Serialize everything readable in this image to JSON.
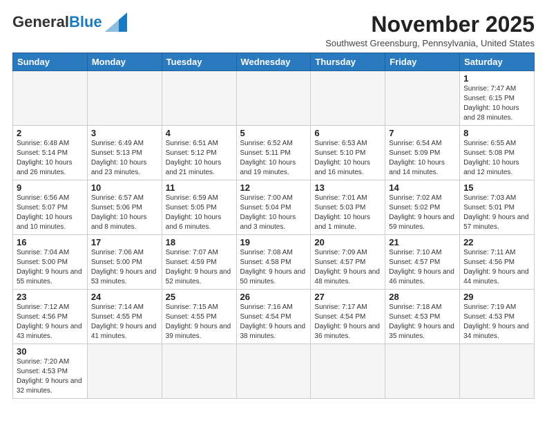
{
  "header": {
    "logo_general": "General",
    "logo_blue": "Blue",
    "month_title": "November 2025",
    "subtitle": "Southwest Greensburg, Pennsylvania, United States"
  },
  "days_of_week": [
    "Sunday",
    "Monday",
    "Tuesday",
    "Wednesday",
    "Thursday",
    "Friday",
    "Saturday"
  ],
  "weeks": [
    [
      {
        "day": "",
        "info": ""
      },
      {
        "day": "",
        "info": ""
      },
      {
        "day": "",
        "info": ""
      },
      {
        "day": "",
        "info": ""
      },
      {
        "day": "",
        "info": ""
      },
      {
        "day": "",
        "info": ""
      },
      {
        "day": "1",
        "info": "Sunrise: 7:47 AM\nSunset: 6:15 PM\nDaylight: 10 hours and 28 minutes."
      }
    ],
    [
      {
        "day": "2",
        "info": "Sunrise: 6:48 AM\nSunset: 5:14 PM\nDaylight: 10 hours and 26 minutes."
      },
      {
        "day": "3",
        "info": "Sunrise: 6:49 AM\nSunset: 5:13 PM\nDaylight: 10 hours and 23 minutes."
      },
      {
        "day": "4",
        "info": "Sunrise: 6:51 AM\nSunset: 5:12 PM\nDaylight: 10 hours and 21 minutes."
      },
      {
        "day": "5",
        "info": "Sunrise: 6:52 AM\nSunset: 5:11 PM\nDaylight: 10 hours and 19 minutes."
      },
      {
        "day": "6",
        "info": "Sunrise: 6:53 AM\nSunset: 5:10 PM\nDaylight: 10 hours and 16 minutes."
      },
      {
        "day": "7",
        "info": "Sunrise: 6:54 AM\nSunset: 5:09 PM\nDaylight: 10 hours and 14 minutes."
      },
      {
        "day": "8",
        "info": "Sunrise: 6:55 AM\nSunset: 5:08 PM\nDaylight: 10 hours and 12 minutes."
      }
    ],
    [
      {
        "day": "9",
        "info": "Sunrise: 6:56 AM\nSunset: 5:07 PM\nDaylight: 10 hours and 10 minutes."
      },
      {
        "day": "10",
        "info": "Sunrise: 6:57 AM\nSunset: 5:06 PM\nDaylight: 10 hours and 8 minutes."
      },
      {
        "day": "11",
        "info": "Sunrise: 6:59 AM\nSunset: 5:05 PM\nDaylight: 10 hours and 6 minutes."
      },
      {
        "day": "12",
        "info": "Sunrise: 7:00 AM\nSunset: 5:04 PM\nDaylight: 10 hours and 3 minutes."
      },
      {
        "day": "13",
        "info": "Sunrise: 7:01 AM\nSunset: 5:03 PM\nDaylight: 10 hours and 1 minute."
      },
      {
        "day": "14",
        "info": "Sunrise: 7:02 AM\nSunset: 5:02 PM\nDaylight: 9 hours and 59 minutes."
      },
      {
        "day": "15",
        "info": "Sunrise: 7:03 AM\nSunset: 5:01 PM\nDaylight: 9 hours and 57 minutes."
      }
    ],
    [
      {
        "day": "16",
        "info": "Sunrise: 7:04 AM\nSunset: 5:00 PM\nDaylight: 9 hours and 55 minutes."
      },
      {
        "day": "17",
        "info": "Sunrise: 7:06 AM\nSunset: 5:00 PM\nDaylight: 9 hours and 53 minutes."
      },
      {
        "day": "18",
        "info": "Sunrise: 7:07 AM\nSunset: 4:59 PM\nDaylight: 9 hours and 52 minutes."
      },
      {
        "day": "19",
        "info": "Sunrise: 7:08 AM\nSunset: 4:58 PM\nDaylight: 9 hours and 50 minutes."
      },
      {
        "day": "20",
        "info": "Sunrise: 7:09 AM\nSunset: 4:57 PM\nDaylight: 9 hours and 48 minutes."
      },
      {
        "day": "21",
        "info": "Sunrise: 7:10 AM\nSunset: 4:57 PM\nDaylight: 9 hours and 46 minutes."
      },
      {
        "day": "22",
        "info": "Sunrise: 7:11 AM\nSunset: 4:56 PM\nDaylight: 9 hours and 44 minutes."
      }
    ],
    [
      {
        "day": "23",
        "info": "Sunrise: 7:12 AM\nSunset: 4:56 PM\nDaylight: 9 hours and 43 minutes."
      },
      {
        "day": "24",
        "info": "Sunrise: 7:14 AM\nSunset: 4:55 PM\nDaylight: 9 hours and 41 minutes."
      },
      {
        "day": "25",
        "info": "Sunrise: 7:15 AM\nSunset: 4:55 PM\nDaylight: 9 hours and 39 minutes."
      },
      {
        "day": "26",
        "info": "Sunrise: 7:16 AM\nSunset: 4:54 PM\nDaylight: 9 hours and 38 minutes."
      },
      {
        "day": "27",
        "info": "Sunrise: 7:17 AM\nSunset: 4:54 PM\nDaylight: 9 hours and 36 minutes."
      },
      {
        "day": "28",
        "info": "Sunrise: 7:18 AM\nSunset: 4:53 PM\nDaylight: 9 hours and 35 minutes."
      },
      {
        "day": "29",
        "info": "Sunrise: 7:19 AM\nSunset: 4:53 PM\nDaylight: 9 hours and 34 minutes."
      }
    ],
    [
      {
        "day": "30",
        "info": "Sunrise: 7:20 AM\nSunset: 4:53 PM\nDaylight: 9 hours and 32 minutes."
      },
      {
        "day": "",
        "info": ""
      },
      {
        "day": "",
        "info": ""
      },
      {
        "day": "",
        "info": ""
      },
      {
        "day": "",
        "info": ""
      },
      {
        "day": "",
        "info": ""
      },
      {
        "day": "",
        "info": ""
      }
    ]
  ]
}
